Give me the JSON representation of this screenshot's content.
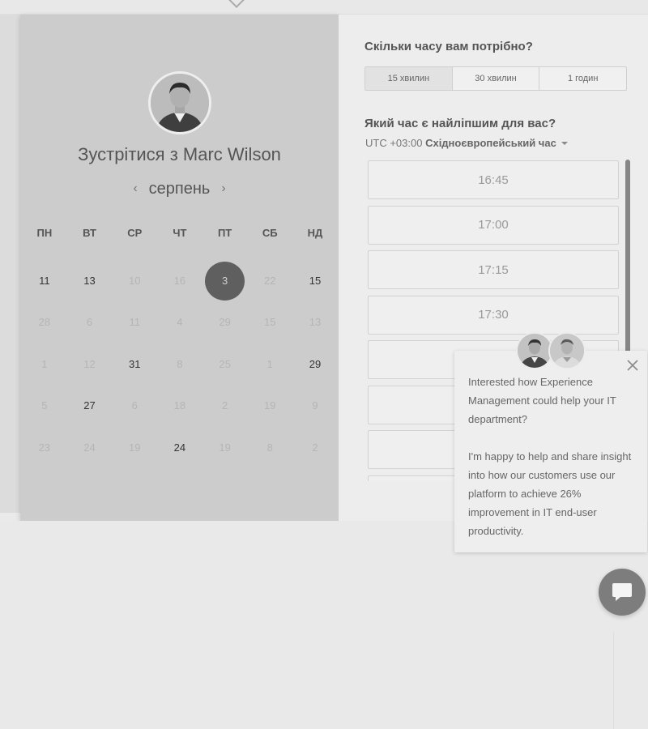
{
  "scheduler": {
    "title": "Зустрітися з Marc Wilson",
    "month": "серпень",
    "weekdays": [
      "ПН",
      "ВТ",
      "СР",
      "ЧТ",
      "ПТ",
      "СБ",
      "НД"
    ],
    "weeks": [
      [
        {
          "d": "11",
          "on": true
        },
        {
          "d": "13",
          "on": true
        },
        {
          "d": "10",
          "on": false
        },
        {
          "d": "16",
          "on": false
        },
        {
          "d": "3",
          "on": true,
          "sel": true
        },
        {
          "d": "22",
          "on": false
        },
        {
          "d": "15",
          "on": true
        }
      ],
      [
        {
          "d": "28",
          "on": false
        },
        {
          "d": "6",
          "on": false
        },
        {
          "d": "11",
          "on": false
        },
        {
          "d": "4",
          "on": false
        },
        {
          "d": "29",
          "on": false
        },
        {
          "d": "15",
          "on": false
        },
        {
          "d": "13",
          "on": false
        }
      ],
      [
        {
          "d": "1",
          "on": false
        },
        {
          "d": "12",
          "on": false
        },
        {
          "d": "31",
          "on": true
        },
        {
          "d": "8",
          "on": false
        },
        {
          "d": "25",
          "on": false
        },
        {
          "d": "1",
          "on": false
        },
        {
          "d": "29",
          "on": true
        }
      ],
      [
        {
          "d": "5",
          "on": false
        },
        {
          "d": "27",
          "on": true
        },
        {
          "d": "6",
          "on": false
        },
        {
          "d": "18",
          "on": false
        },
        {
          "d": "2",
          "on": false
        },
        {
          "d": "19",
          "on": false
        },
        {
          "d": "9",
          "on": false
        }
      ],
      [
        {
          "d": "23",
          "on": false
        },
        {
          "d": "24",
          "on": false
        },
        {
          "d": "19",
          "on": false
        },
        {
          "d": "24",
          "on": true
        },
        {
          "d": "19",
          "on": false
        },
        {
          "d": "8",
          "on": false
        },
        {
          "d": "2",
          "on": false
        }
      ]
    ]
  },
  "duration": {
    "question": "Скільки часу вам потрібно?",
    "options": [
      "15 хвилин",
      "30 хвилин",
      "1 годин"
    ]
  },
  "time": {
    "question": "Який час є найліпшим для вас?",
    "tz_offset": "UTC +03:00",
    "tz_name": "Східноєвропейський час",
    "slots": [
      "16:45",
      "17:00",
      "17:15",
      "17:30",
      "",
      "",
      "",
      ""
    ]
  },
  "chat_popup": {
    "para1": "Interested how Experience Management could help your IT department?",
    "para2": "I'm happy to help and share insight into how our customers use our platform to achieve 26% improvement in IT end-user productivity."
  }
}
